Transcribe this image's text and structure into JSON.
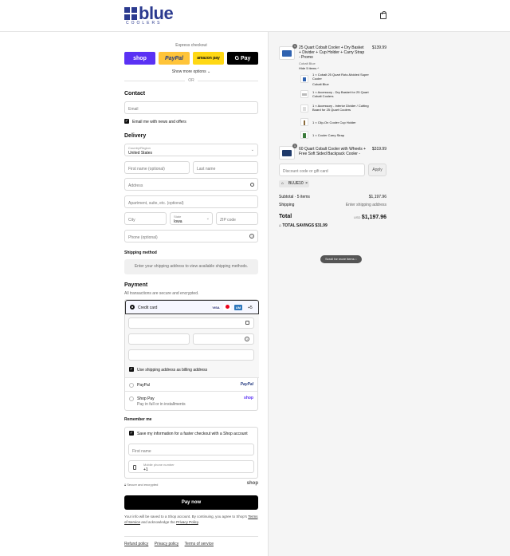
{
  "brand": {
    "name": "blue",
    "subtitle": "COOLERS",
    "accent": "#2b3a8f"
  },
  "header": {
    "cart_icon": "shopping-bag-icon"
  },
  "express": {
    "title": "Express checkout",
    "shop": "shop",
    "paypal": "PayPal",
    "amazon": "amazon pay",
    "gpay": "G Pay",
    "show_more": "Show more options",
    "or": "OR"
  },
  "contact": {
    "heading": "Contact",
    "email_placeholder": "Email",
    "newsletter_label": "Email me with news and offers",
    "newsletter_checked": true
  },
  "delivery": {
    "heading": "Delivery",
    "country_label": "Country/Region",
    "country_value": "United States",
    "first_name": "First name (optional)",
    "last_name": "Last name",
    "address": "Address",
    "apartment": "Apartment, suite, etc. (optional)",
    "city": "City",
    "state_label": "State",
    "state_value": "Iowa",
    "zip": "ZIP code",
    "phone": "Phone (optional)"
  },
  "shipping": {
    "heading": "Shipping method",
    "note": "Enter your shipping address to view available shipping methods."
  },
  "payment": {
    "heading": "Payment",
    "subtitle": "All transactions are secure and encrypted.",
    "credit_card": "Credit card",
    "more_cards": "+5",
    "billing_label": "Use shipping address as billing address",
    "paypal": "PayPal",
    "paypal_logo": "PayPal",
    "shop_pay": "Shop Pay",
    "shop_pay_sub": "Pay in full or in installments",
    "shop_logo": "shop"
  },
  "remember": {
    "heading": "Remember me",
    "save_label": "Save my information for a faster checkout with a Shop account",
    "first_name": "First name",
    "mobile_label": "Mobile phone number",
    "mobile_value": "+1",
    "secure": "Secure and encrypted",
    "shop": "shop"
  },
  "paynow": {
    "label": "Pay now"
  },
  "legal": {
    "text_a": "Your info will be saved to a Shop account. By continuing, you agree to Shop's",
    "terms": "Terms of Service",
    "text_b": "and acknowledge the",
    "privacy": "Privacy Policy",
    "period": "."
  },
  "footer": {
    "refund": "Refund policy",
    "privacy": "Privacy policy",
    "terms": "Terms of service"
  },
  "summary": {
    "item1": {
      "qty": "1",
      "name": "25 Quart Cobalt Cooler + Dry Basket + Divider + Cup Holder + Carry Strap - Promo",
      "variant": "Cobalt Blue",
      "price": "$139.99",
      "hide": "Hide 5 items"
    },
    "sub_items": [
      {
        "name": "1 × Cobalt 25 Quart Roto-Molded Super Cooler",
        "variant": "Cobalt Blue"
      },
      {
        "name": "1 × Accessory - Dry Basket for 25 Quart Cobalt Coolers",
        "variant": ""
      },
      {
        "name": "1 × Accessory - Interior Divider / Cutting Board for 25 Quart Coolers",
        "variant": ""
      },
      {
        "name": "1 × Clip-On Cooler Cup Holder",
        "variant": ""
      },
      {
        "name": "1 × Cooler Carry Strap",
        "variant": ""
      }
    ],
    "item2": {
      "qty": "1",
      "name": "60 Quart Cobalt Cooler with Wheels + Free Soft Sided Backpack Cooler -",
      "price": "$319.99"
    },
    "scroll_hint": "Scroll for more items",
    "discount_placeholder": "Discount code or gift card",
    "apply": "Apply",
    "code": "BLUE10",
    "subtotal_label": "Subtotal · 5 items",
    "subtotal_value": "$1,197.96",
    "shipping_label": "Shipping",
    "shipping_value": "Enter shipping address",
    "total_label": "Total",
    "currency": "USD",
    "total_value": "$1,197.96",
    "savings_label": "TOTAL SAVINGS",
    "savings_value": "$31.99"
  }
}
